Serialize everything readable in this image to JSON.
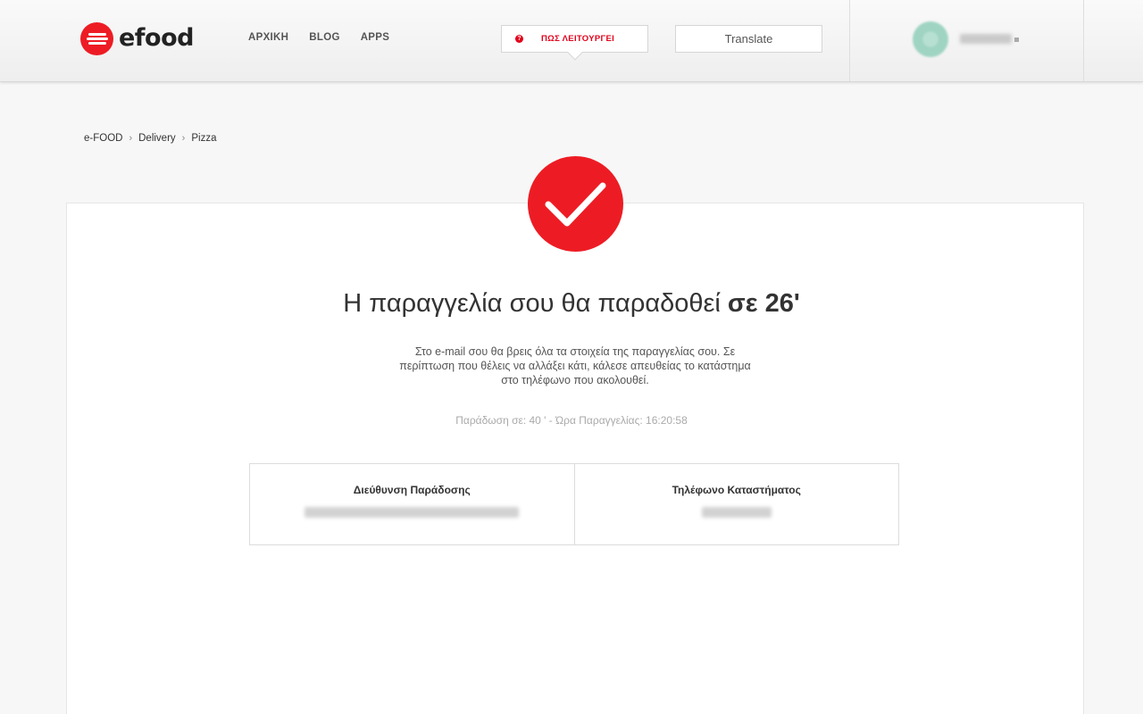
{
  "header": {
    "logo_text": "efood",
    "nav": [
      "ΑΡΧΙΚΗ",
      "BLOG",
      "APPS"
    ],
    "how_it_works": "ΠΩΣ ΛΕΙΤΟΥΡΓΕΙ",
    "how_icon": "?",
    "translate": "Translate"
  },
  "breadcrumb": [
    "e-FOOD",
    "Delivery",
    "Pizza"
  ],
  "breadcrumb_separator": "›",
  "confirmation": {
    "headline_main": "Η παραγγελία σου θα παραδοθεί ",
    "headline_time": "σε 26'",
    "description": "Στο e-mail σου θα βρεις όλα τα στοιχεία της παραγγελίας σου. Σε περίπτωση που θέλεις να αλλάξει κάτι, κάλεσε απευθείας το κατάστημα στο τηλέφωνο που ακολουθεί.",
    "meta": "Παράδωση σε: 40 ' - Ώρα Παραγγελίας: 16:20:58"
  },
  "info": {
    "address_title": "Διεύθυνση Παράδοσης",
    "phone_title": "Τηλέφωνο Καταστήματος"
  },
  "colors": {
    "brand_red": "#ed1c24",
    "accent_red": "#e2001a"
  }
}
